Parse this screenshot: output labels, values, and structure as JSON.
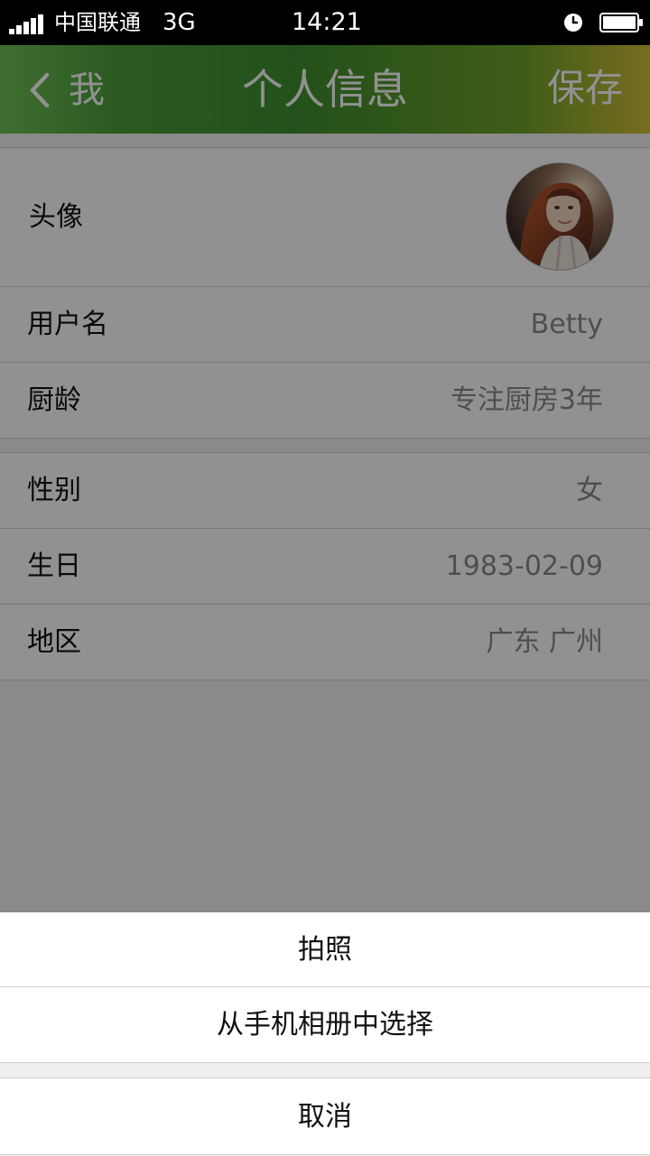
{
  "status_bar": {
    "carrier": "中国联通",
    "network": "3G",
    "time": "14:21",
    "signal_icon": "signal-icon",
    "alarm_icon": "alarm-icon",
    "battery_icon": "battery-icon"
  },
  "header": {
    "back_label": "我",
    "title": "个人信息",
    "save_label": "保存",
    "back_icon": "chevron-left-icon"
  },
  "profile": {
    "avatar_label": "头像",
    "avatar_icon": "avatar-photo",
    "rows": [
      {
        "label": "用户名",
        "value": "Betty"
      },
      {
        "label": "厨龄",
        "value": "专注厨房3年"
      },
      {
        "label": "性别",
        "value": "女"
      },
      {
        "label": "生日",
        "value": "1983-02-09"
      },
      {
        "label": "地区",
        "value": "广东 广州"
      }
    ]
  },
  "action_sheet": {
    "take_photo": "拍照",
    "choose_from_album": "从手机相册中选择",
    "cancel": "取消"
  },
  "colors": {
    "header_gradient_start": "#6fc256",
    "header_gradient_end": "#d3bf39",
    "overlay": "rgba(0,0,0,0.43)",
    "value_text": "#8a8a8a"
  }
}
